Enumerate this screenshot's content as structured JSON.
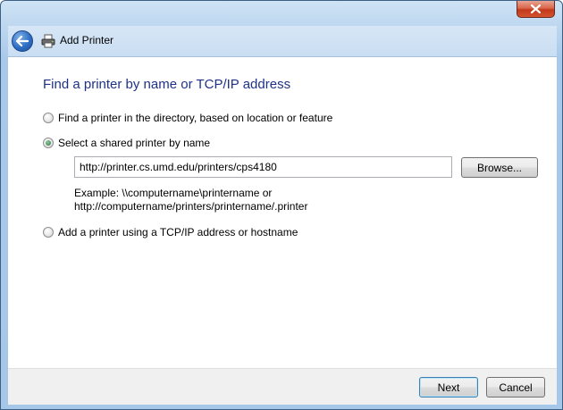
{
  "window": {
    "title": "Add Printer",
    "close_icon": "close-icon"
  },
  "header": {
    "back_icon": "back-arrow-icon",
    "printer_icon": "printer-icon",
    "title": "Add Printer"
  },
  "main": {
    "heading": "Find a printer by name or TCP/IP address",
    "options": [
      {
        "label": "Find a printer in the directory, based on location or feature",
        "checked": false
      },
      {
        "label": "Select a shared printer by name",
        "checked": true
      },
      {
        "label": "Add a printer using a TCP/IP address or hostname",
        "checked": false
      }
    ],
    "printer_path": {
      "value": "http://printer.cs.umd.edu/printers/cps4180"
    },
    "browse_label": "Browse...",
    "example_line1": "Example: \\\\computername\\printername or",
    "example_line2": "http://computername/printers/printername/.printer"
  },
  "footer": {
    "next_label": "Next",
    "cancel_label": "Cancel"
  }
}
